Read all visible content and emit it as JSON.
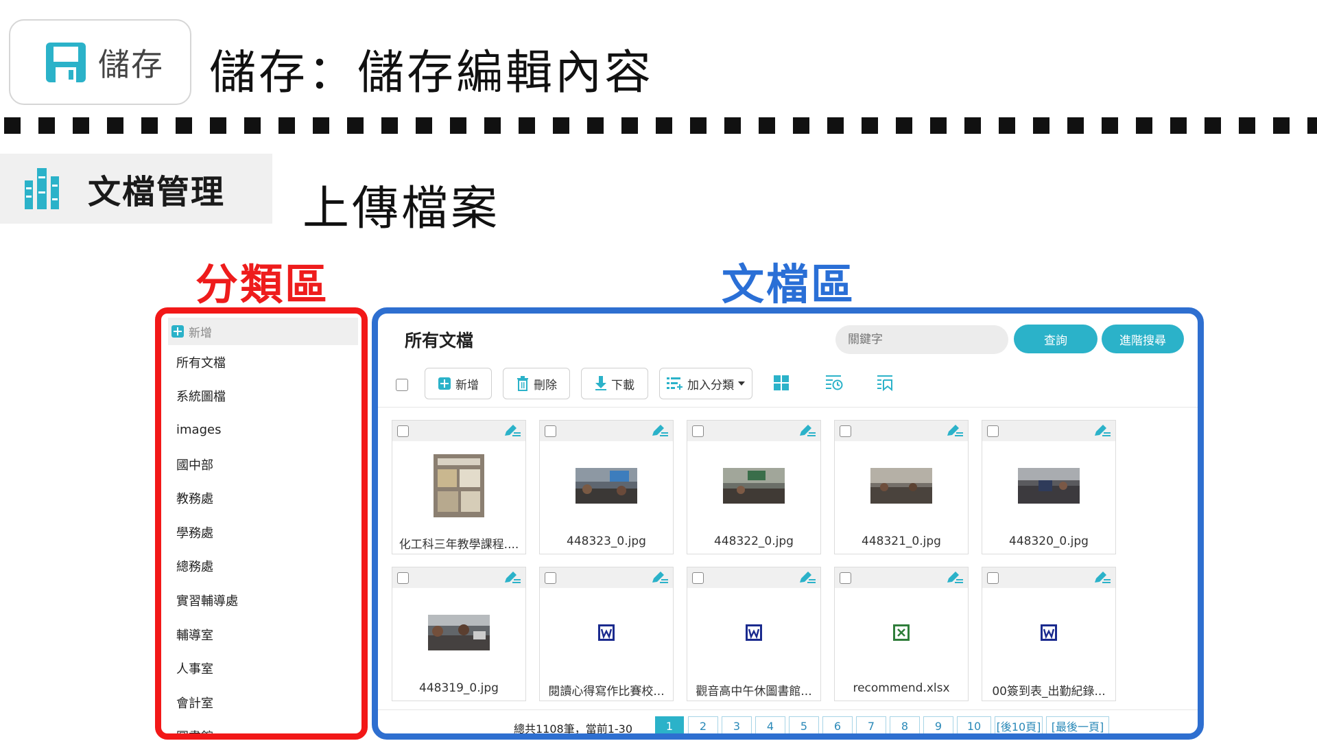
{
  "save": {
    "button_label": "儲存",
    "title": "儲存：儲存編輯內容"
  },
  "docmgmt": {
    "banner_label": "文檔管理",
    "title": "上傳檔案"
  },
  "headings": {
    "category": "分類區",
    "documents": "文檔區"
  },
  "category_panel": {
    "add_label": "新增",
    "items": [
      "所有文檔",
      "系統圖檔",
      "images",
      "國中部",
      "教務處",
      "學務處",
      "總務處",
      "實習輔導處",
      "輔導室",
      "人事室",
      "會計室",
      "圖書館"
    ]
  },
  "doc_panel": {
    "title": "所有文檔",
    "search_placeholder": "關鍵字",
    "query_label": "查詢",
    "advanced_label": "進階搜尋",
    "toolbar": {
      "add": "新增",
      "delete": "刪除",
      "download": "下載",
      "add_category": "加入分類"
    },
    "files": [
      {
        "name": "化工科三年教學課程....",
        "type": "poster"
      },
      {
        "name": "448323_0.jpg",
        "type": "photo"
      },
      {
        "name": "448322_0.jpg",
        "type": "photo"
      },
      {
        "name": "448321_0.jpg",
        "type": "photo"
      },
      {
        "name": "448320_0.jpg",
        "type": "photo"
      },
      {
        "name": "448319_0.jpg",
        "type": "photo"
      },
      {
        "name": "閱讀心得寫作比賽校...",
        "type": "word"
      },
      {
        "name": "觀音高中午休圖書館...",
        "type": "word"
      },
      {
        "name": "recommend.xlsx",
        "type": "excel"
      },
      {
        "name": "00簽到表_出勤紀錄...",
        "type": "word"
      }
    ],
    "pager": {
      "total_text": "總共1108筆，當前1-30",
      "pages": [
        "1",
        "2",
        "3",
        "4",
        "5",
        "6",
        "7",
        "8",
        "9",
        "10"
      ],
      "next10": "[後10頁]",
      "last": "[最後一頁]"
    }
  },
  "colors": {
    "accent": "#2bb2c9",
    "category_frame": "#f21818",
    "doc_frame": "#2e6fd0"
  }
}
